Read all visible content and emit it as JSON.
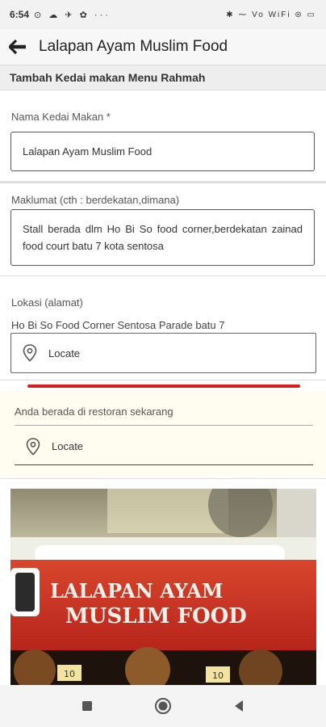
{
  "status_bar": {
    "time": "6:54",
    "left_icons": "⊙ ☁ ✈ ✿ ···",
    "right_icons": "✱ ⁓ Vo WiFi ⊜ ▭"
  },
  "app_bar": {
    "title": "Lalapan Ayam Muslim Food",
    "back_icon": "arrow-left-icon"
  },
  "section_header": "Tambah Kedai makan Menu Rahmah",
  "form": {
    "name_label": "Nama Kedai Makan *",
    "name_value": "Lalapan Ayam Muslim Food",
    "info_label": "Maklumat (cth : berdekatan,dimana)",
    "info_value": "Stall berada dlm Ho Bi So food corner,berdekatan zainad food court batu 7 kota sentosa",
    "location_label": "Lokasi (alamat)",
    "location_value": "Ho Bi So Food Corner Sentosa Parade batu 7",
    "locate_label": "Locate"
  },
  "restaurant_panel": {
    "label": "Anda berada di restoran sekarang",
    "locate_label": "Locate"
  },
  "photo": {
    "sign_line1": "LALAPAN AYAM",
    "sign_line2": "MUSLIM FOOD",
    "price_tag_1": "10",
    "price_tag_2": "10"
  },
  "colors": {
    "accent_red": "#d71f1f",
    "sign_red": "#c62a1f",
    "panel_bg": "#fffdf0"
  }
}
